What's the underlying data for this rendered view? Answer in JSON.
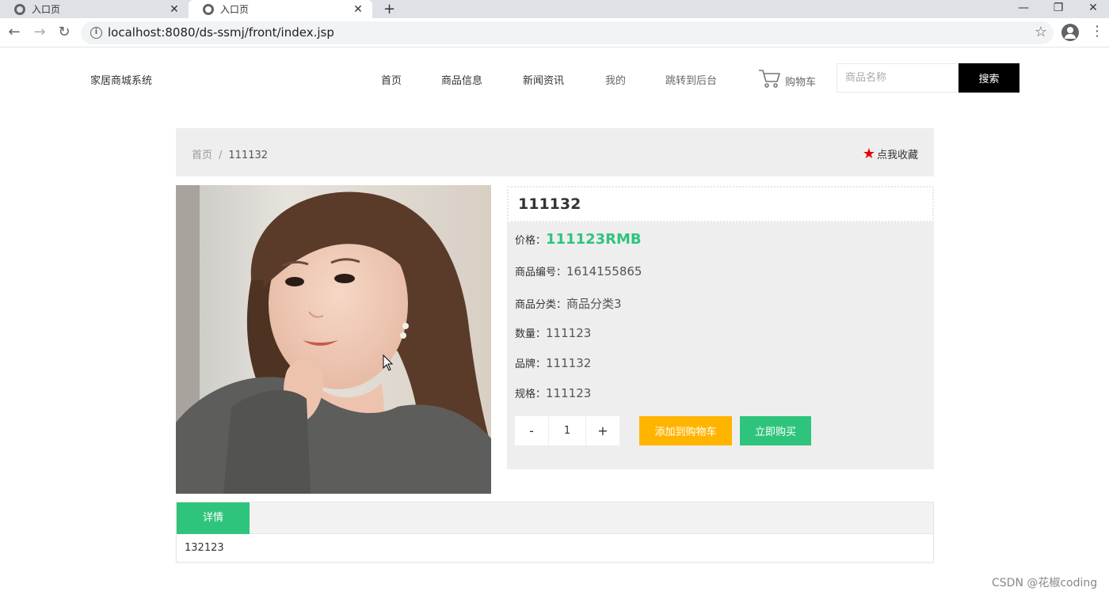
{
  "browser": {
    "tabs": [
      {
        "title": "入口页",
        "active": false
      },
      {
        "title": "入口页",
        "active": true
      }
    ],
    "new_tab": "+",
    "window_controls": {
      "minimize": "—",
      "restore": "❐",
      "close": "✕"
    },
    "url": "localhost:8080/ds-ssmj/front/index.jsp"
  },
  "header": {
    "brand": "家居商城系统",
    "nav": [
      "首页",
      "商品信息",
      "新闻资讯",
      "我的",
      "跳转到后台"
    ],
    "cart_label": "购物车",
    "search_placeholder": "商品名称",
    "search_button": "搜索"
  },
  "breadcrumb": {
    "home": "首页",
    "separator": "/",
    "current": "111132",
    "favorite": "点我收藏"
  },
  "product": {
    "title": "111132",
    "price_label": "价格：",
    "price": "111123RMB",
    "code_label": "商品编号：",
    "code": "1614155865",
    "category_label": "商品分类：",
    "category": "商品分类3",
    "quantity_label": "数量：",
    "quantity": "111123",
    "brand_label": "品牌：",
    "brand": "111132",
    "spec_label": "规格：",
    "spec": "111123",
    "order_qty": "1",
    "minus": "-",
    "plus": "+",
    "add_to_cart": "添加到购物车",
    "buy_now": "立即购买"
  },
  "details": {
    "tab": "详情",
    "content": "132123"
  },
  "watermark": "CSDN @花椒coding",
  "colors": {
    "accent": "#2fc47c",
    "cart_button": "#ffb400",
    "favorite_star": "#e60000"
  }
}
